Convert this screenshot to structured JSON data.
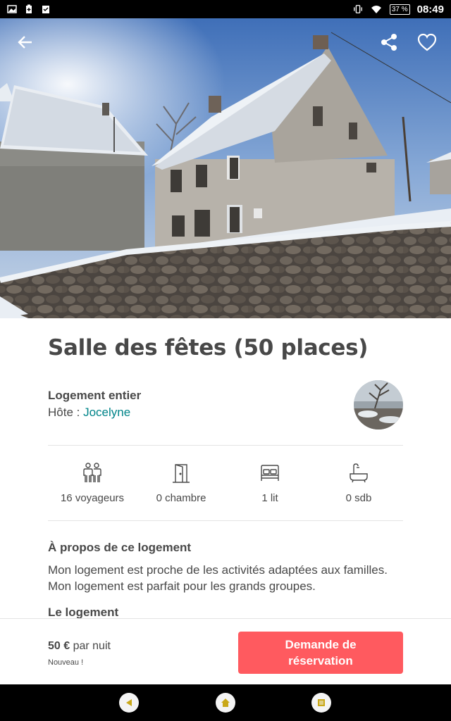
{
  "status_bar": {
    "battery": "37 %",
    "time": "08:49"
  },
  "listing": {
    "title": "Salle des fêtes (50 places)",
    "type": "Logement entier",
    "host_prefix": "Hôte : ",
    "host_name": "Jocelyne"
  },
  "amenities": [
    {
      "icon": "guests-icon",
      "label": "16 voyageurs"
    },
    {
      "icon": "door-icon",
      "label": "0 chambre"
    },
    {
      "icon": "bed-icon",
      "label": "1 lit"
    },
    {
      "icon": "bathtub-icon",
      "label": "0 sdb"
    }
  ],
  "about": {
    "title": "À propos de ce logement",
    "text": "Mon logement est proche de les activités adaptées aux familles. Mon logement est parfait pour les grands groupes.",
    "next_section": "Le logement"
  },
  "booking": {
    "price_amount": "50 €",
    "price_unit": " par nuit",
    "badge": "Nouveau !",
    "button_label": "Demande de réservation"
  },
  "colors": {
    "accent": "#ff5a5f",
    "host_link": "#008489",
    "text": "#484848"
  }
}
